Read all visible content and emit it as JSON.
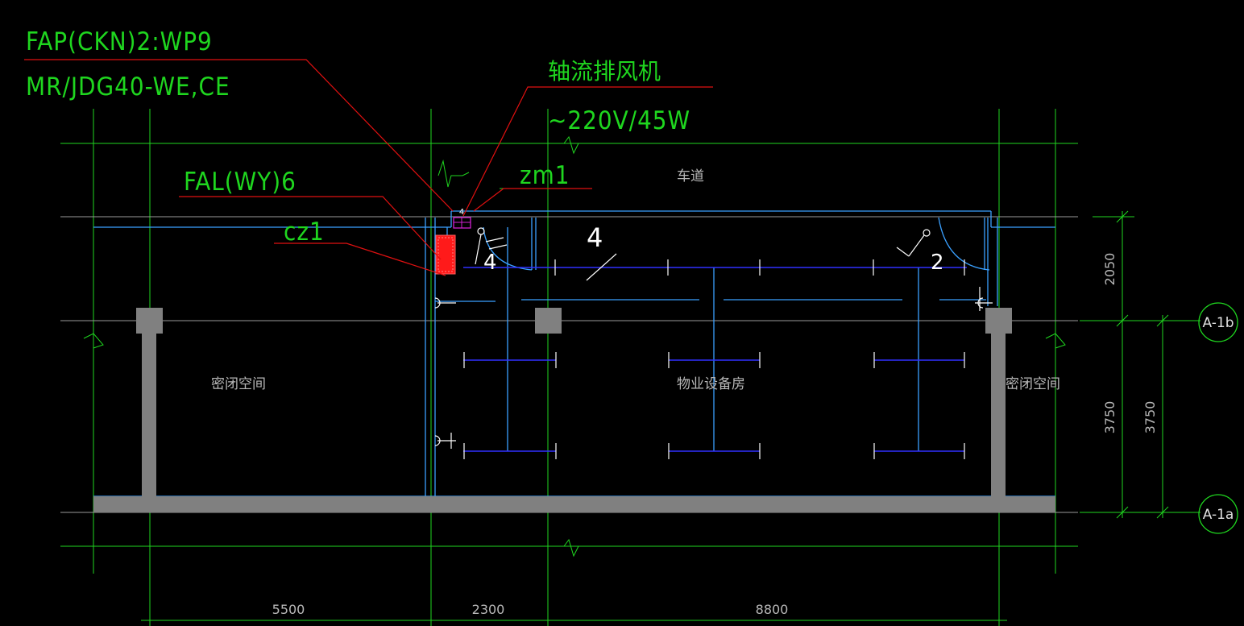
{
  "labels": {
    "fap": "FAP(CKN)2:WP9",
    "mr": "MR/JDG40-WE,CE",
    "fan_name": "轴流排风机",
    "fan_spec": "~220V/45W",
    "fal": "FAL(WY)6",
    "zm": "zm1",
    "cz": "cz1",
    "fan_tag": "4"
  },
  "rooms": {
    "driveway": "车道",
    "closed_left": "密闭空间",
    "equipment": "物业设备房",
    "closed_right": "密闭空间"
  },
  "marks": {
    "circuit_4": "4",
    "circuit_4b": "4",
    "circuit_2": "2"
  },
  "dimensions": {
    "bottom": [
      "5500",
      "2300",
      "8800"
    ],
    "right_upper": "2050",
    "right_lower": "3750",
    "right_outer": "3750"
  },
  "axes": {
    "upper": "A-1b",
    "lower": "A-1a"
  },
  "colors": {
    "background": "#000000",
    "dimension": "#1fd61f",
    "wall": "#3aa0ff",
    "leader": "#e01010",
    "column": "#808080",
    "lighting": "#2a2aff",
    "panel": "#ff1a1a",
    "fan": "#d020d0",
    "text": "#b8b8b8"
  }
}
